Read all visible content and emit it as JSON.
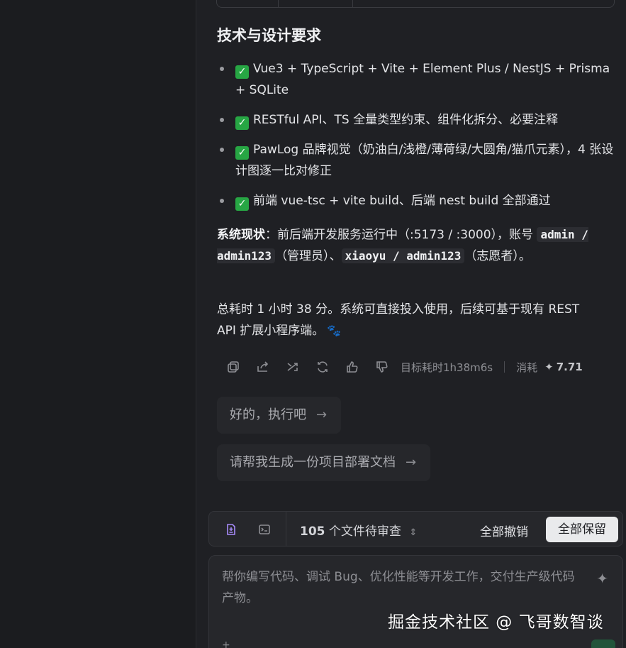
{
  "content": {
    "heading": "技术与设计要求",
    "checklist": [
      "Vue3 + TypeScript + Vite + Element Plus / NestJS + Prisma + SQLite",
      "RESTful API、TS 全量类型约束、组件化拆分、必要注释",
      "PawLog 品牌视觉（奶油白/浅橙/薄荷绿/大圆角/猫爪元素），4 张设计图逐一比对修正",
      "前端 vue-tsc + vite build、后端 nest build 全部通过"
    ],
    "status": {
      "label": "系统现状",
      "text1": "：前后端开发服务运行中（:5173 / :3000），账号",
      "account1": "admin / admin123",
      "text2": "（管理员）、",
      "account2": "xiaoyu / admin123",
      "text3": "（志愿者）。"
    },
    "summary": "总耗时 1 小时 38 分。系统可直接投入使用，后续可基于现有 REST API 扩展小程序端。",
    "paw_glyph": "🐾"
  },
  "actions": {
    "icons": [
      "copy-icon",
      "share-icon",
      "fork-icon",
      "refresh-icon",
      "thumbs-up-icon",
      "thumbs-down-icon"
    ],
    "target_time": "目标耗时1h38m6s",
    "consume_label": "消耗",
    "consume_value": "7.71"
  },
  "suggestions": [
    "好的，执行吧",
    "请帮我生成一份项目部署文档"
  ],
  "review_bar": {
    "count": "105",
    "count_text": "个文件待审查",
    "undo_all": "全部撤销",
    "keep_all": "全部保留"
  },
  "input": {
    "placeholder": "帮你编写代码、调试 Bug、优化性能等开发工作，交付生产级代码产物。"
  },
  "watermark": "掘金技术社区 @ 飞哥数智谈",
  "colors": {
    "background": "#1f2024",
    "check_green": "#27a644",
    "keep_button_bg": "#e9eaec"
  }
}
